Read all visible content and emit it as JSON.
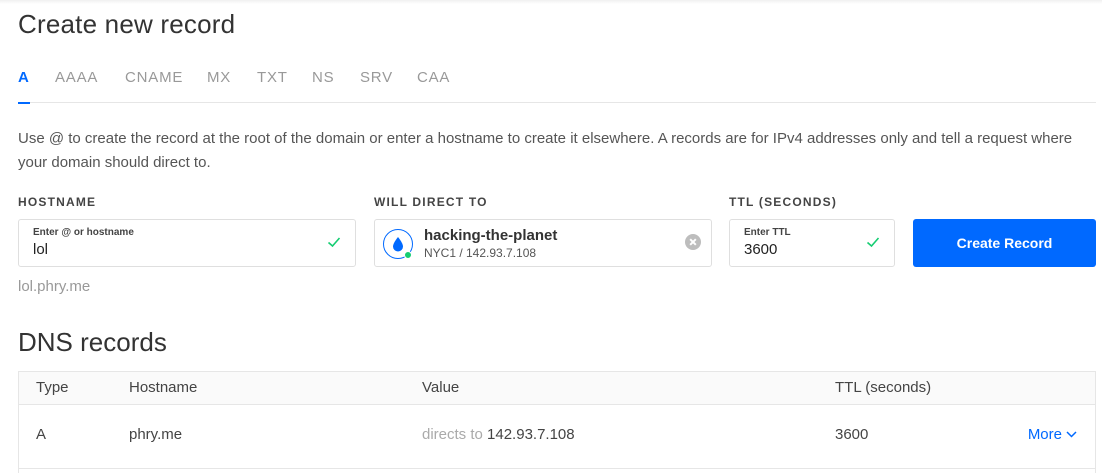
{
  "page_title": "Create new record",
  "tabs": [
    {
      "label": "A",
      "active": true
    },
    {
      "label": "AAAA"
    },
    {
      "label": "CNAME"
    },
    {
      "label": "MX"
    },
    {
      "label": "TXT"
    },
    {
      "label": "NS"
    },
    {
      "label": "SRV"
    },
    {
      "label": "CAA"
    }
  ],
  "help_text": "Use @ to create the record at the root of the domain or enter a hostname to create it elsewhere. A records are for IPv4 addresses only and tell a request where your domain should direct to.",
  "form": {
    "hostname": {
      "label": "HOSTNAME",
      "mini_label": "Enter @ or hostname",
      "value": "lol",
      "preview": "lol.phry.me"
    },
    "direct_to": {
      "label": "WILL DIRECT TO",
      "droplet_name": "hacking-the-planet",
      "droplet_detail": "NYC1 / 142.93.7.108"
    },
    "ttl": {
      "label": "TTL (SECONDS)",
      "mini_label": "Enter TTL",
      "value": "3600"
    },
    "submit_label": "Create Record"
  },
  "dns_section": {
    "title": "DNS records",
    "columns": [
      "Type",
      "Hostname",
      "Value",
      "TTL (seconds)"
    ],
    "rows": [
      {
        "type": "A",
        "hostname": "phry.me",
        "value_prefix": "directs to",
        "value": "142.93.7.108",
        "ttl": "3600",
        "action": "More"
      }
    ]
  },
  "colors": {
    "accent": "#0069ff",
    "success": "#15cd72",
    "muted": "#999999"
  }
}
